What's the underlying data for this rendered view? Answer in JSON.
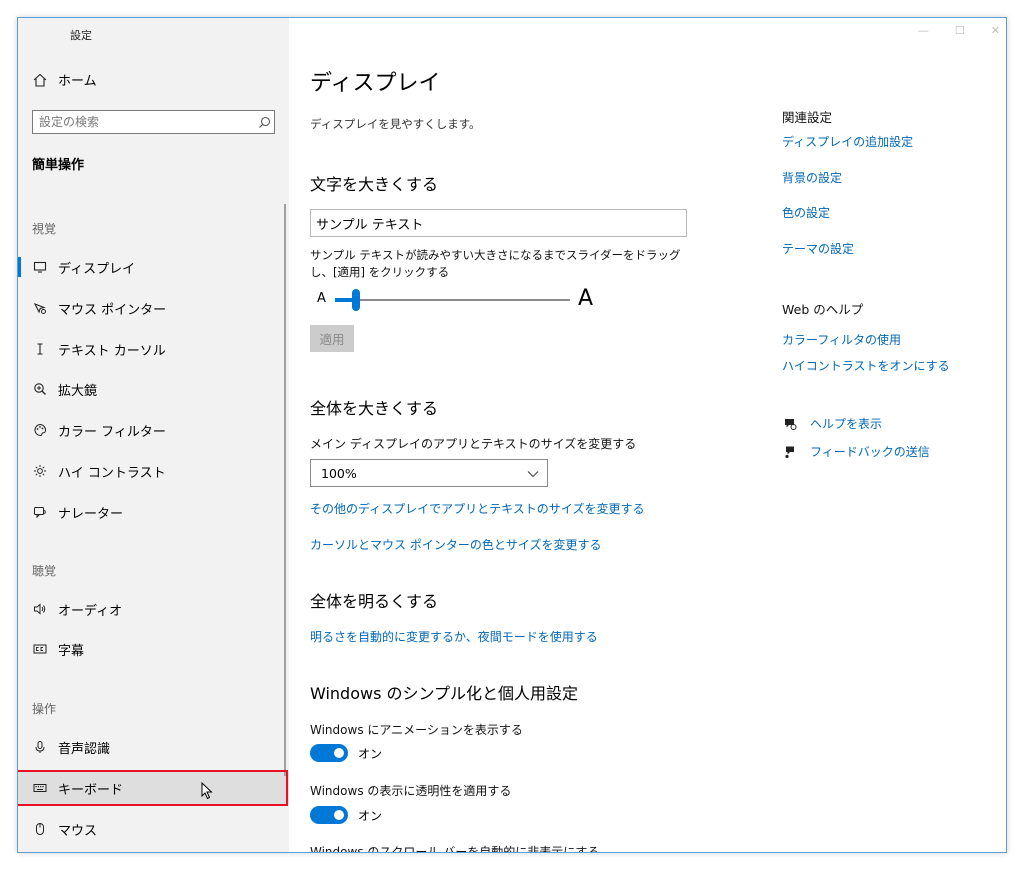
{
  "app": {
    "title": "設定"
  },
  "sidebar": {
    "home_label": "ホーム",
    "search_placeholder": "設定の検索",
    "section_title": "簡単操作",
    "groups": {
      "vision": "視覚",
      "hearing": "聴覚",
      "interaction": "操作"
    },
    "items": [
      {
        "label": "ディスプレイ",
        "icon": "monitor-icon"
      },
      {
        "label": "マウス ポインター",
        "icon": "pointer-icon"
      },
      {
        "label": "テキスト カーソル",
        "icon": "text-cursor-icon"
      },
      {
        "label": "拡大鏡",
        "icon": "magnifier-icon"
      },
      {
        "label": "カラー フィルター",
        "icon": "palette-icon"
      },
      {
        "label": "ハイ コントラスト",
        "icon": "brightness-icon"
      },
      {
        "label": "ナレーター",
        "icon": "narrator-icon"
      },
      {
        "label": "オーディオ",
        "icon": "speaker-icon"
      },
      {
        "label": "字幕",
        "icon": "captions-icon"
      },
      {
        "label": "音声認識",
        "icon": "microphone-icon"
      },
      {
        "label": "キーボード",
        "icon": "keyboard-icon"
      },
      {
        "label": "マウス",
        "icon": "mouse-icon"
      }
    ]
  },
  "main": {
    "title": "ディスプレイ",
    "description": "ディスプレイを見やすくします。",
    "text_size": {
      "heading": "文字を大きくする",
      "preview_text": "サンプル テキスト",
      "hint": "サンプル テキストが読みやすい大きさになるまでスライダーをドラッグし、[適用] をクリックする",
      "small_a": "A",
      "large_a": "A",
      "slider_fraction": 0.09,
      "apply_label": "適用"
    },
    "scale": {
      "heading": "全体を大きくする",
      "label": "メイン ディスプレイのアプリとテキストのサイズを変更する",
      "value": "100%",
      "link1": "その他のディスプレイでアプリとテキストのサイズを変更する",
      "link2": "カーソルとマウス ポインターの色とサイズを変更する"
    },
    "brightness": {
      "heading": "全体を明るくする",
      "link": "明るさを自動的に変更するか、夜間モードを使用する"
    },
    "simplify": {
      "heading": "Windows のシンプル化と個人用設定",
      "animation_label": "Windows にアニメーションを表示する",
      "animation_state": "オン",
      "transparency_label": "Windows の表示に透明性を適用する",
      "transparency_state": "オン",
      "scrollbar_label": "Windows のスクロール バーを自動的に非表示にする"
    }
  },
  "related": {
    "title": "関連設定",
    "links": [
      "ディスプレイの追加設定",
      "背景の設定",
      "色の設定",
      "テーマの設定"
    ],
    "web_help_title": "Web のヘルプ",
    "web_links": [
      "カラーフィルタの使用",
      "ハイコントラストをオンにする"
    ],
    "help_label": "ヘルプを表示",
    "feedback_label": "フィードバックの送信"
  },
  "colors": {
    "accent": "#0078d7",
    "link": "#0067b8",
    "highlight": "#e81123"
  }
}
